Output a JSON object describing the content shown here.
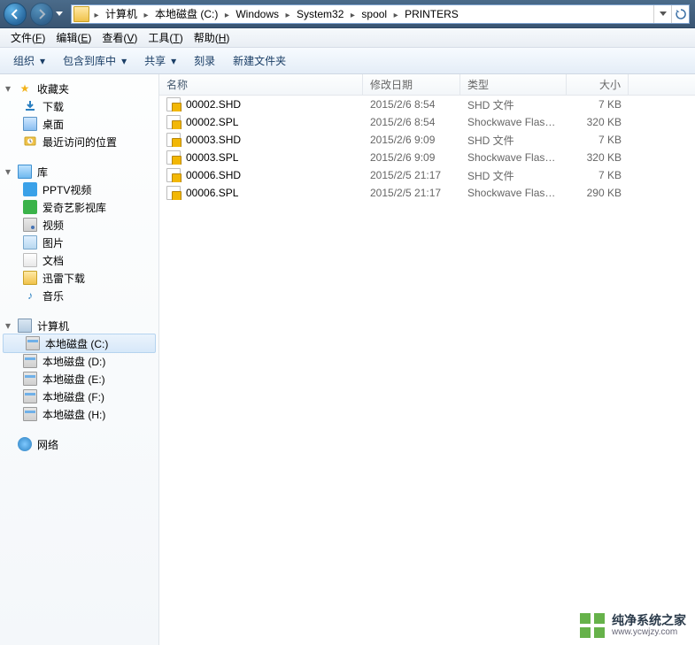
{
  "breadcrumb": [
    "计算机",
    "本地磁盘 (C:)",
    "Windows",
    "System32",
    "spool",
    "PRINTERS"
  ],
  "menu": [
    {
      "label": "文件",
      "accel": "F"
    },
    {
      "label": "编辑",
      "accel": "E"
    },
    {
      "label": "查看",
      "accel": "V"
    },
    {
      "label": "工具",
      "accel": "T"
    },
    {
      "label": "帮助",
      "accel": "H"
    }
  ],
  "toolbar": {
    "organize": "组织",
    "include": "包含到库中",
    "share": "共享",
    "burn": "刻录",
    "newfolder": "新建文件夹"
  },
  "nav": {
    "favorites": {
      "label": "收藏夹",
      "items": [
        "下载",
        "桌面",
        "最近访问的位置"
      ]
    },
    "libraries": {
      "label": "库",
      "items": [
        "PPTV视频",
        "爱奇艺影视库",
        "视频",
        "图片",
        "文档",
        "迅雷下载",
        "音乐"
      ]
    },
    "computer": {
      "label": "计算机",
      "items": [
        "本地磁盘 (C:)",
        "本地磁盘 (D:)",
        "本地磁盘 (E:)",
        "本地磁盘 (F:)",
        "本地磁盘 (H:)"
      ]
    },
    "network": {
      "label": "网络"
    }
  },
  "columns": {
    "name": "名称",
    "date": "修改日期",
    "type": "类型",
    "size": "大小"
  },
  "files": [
    {
      "name": "00002.SHD",
      "date": "2015/2/6 8:54",
      "type": "SHD 文件",
      "size": "7 KB"
    },
    {
      "name": "00002.SPL",
      "date": "2015/2/6 8:54",
      "type": "Shockwave Flash...",
      "size": "320 KB"
    },
    {
      "name": "00003.SHD",
      "date": "2015/2/6 9:09",
      "type": "SHD 文件",
      "size": "7 KB"
    },
    {
      "name": "00003.SPL",
      "date": "2015/2/6 9:09",
      "type": "Shockwave Flash...",
      "size": "320 KB"
    },
    {
      "name": "00006.SHD",
      "date": "2015/2/5 21:17",
      "type": "SHD 文件",
      "size": "7 KB"
    },
    {
      "name": "00006.SPL",
      "date": "2015/2/5 21:17",
      "type": "Shockwave Flash...",
      "size": "290 KB"
    }
  ],
  "selected_drive_index": 0,
  "watermark": {
    "title": "纯净系统之家",
    "url": "www.ycwjzy.com"
  }
}
